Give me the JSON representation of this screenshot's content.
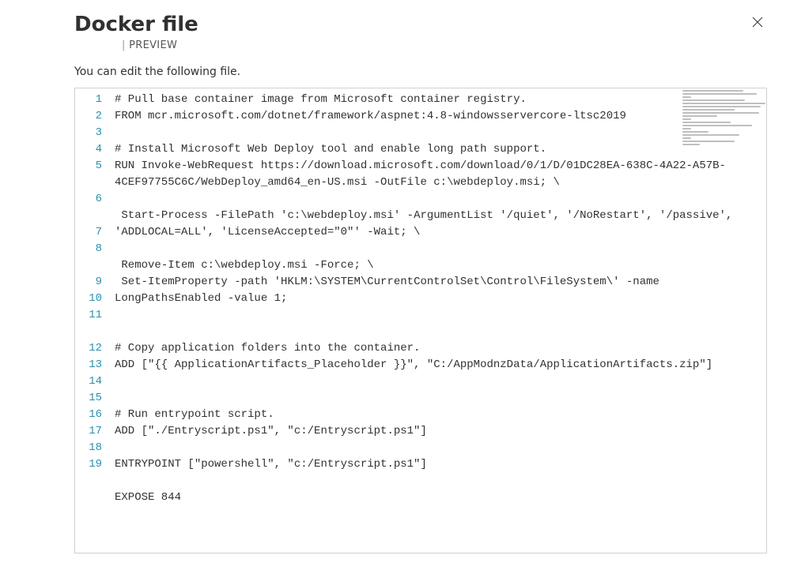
{
  "header": {
    "title": "Docker file",
    "divider": "|",
    "preview": "PREVIEW"
  },
  "subtitle": "You can edit the following file.",
  "lineNumbers": [
    "1",
    "2",
    "3",
    "4",
    "5",
    "",
    "6",
    "",
    "7",
    "8",
    "",
    "9",
    "10",
    "11",
    "",
    "12",
    "13",
    "14",
    "15",
    "16",
    "17",
    "18",
    "19"
  ],
  "codeLines": [
    "# Pull base container image from Microsoft container registry.",
    "FROM mcr.microsoft.com/dotnet/framework/aspnet:4.8-windowsservercore-ltsc2019",
    "",
    "# Install Microsoft Web Deploy tool and enable long path support.",
    "RUN Invoke-WebRequest https://download.microsoft.com/download/0/1/D/01DC28EA-638C-4A22-A57B-4CEF97755C6C/WebDeploy_amd64_en-US.msi -OutFile c:\\webdeploy.msi; \\",
    "",
    " Start-Process -FilePath 'c:\\webdeploy.msi' -ArgumentList '/quiet', '/NoRestart', '/passive', 'ADDLOCAL=ALL', 'LicenseAccepted=\"0\"' -Wait; \\",
    "",
    " Remove-Item c:\\webdeploy.msi -Force; \\",
    " Set-ItemProperty -path 'HKLM:\\SYSTEM\\CurrentControlSet\\Control\\FileSystem\\' -name LongPathsEnabled -value 1;",
    "",
    "",
    "# Copy application folders into the container.",
    "ADD [\"{{ ApplicationArtifacts_Placeholder }}\", \"C:/AppModnzData/ApplicationArtifacts.zip\"]",
    "",
    "",
    "# Run entrypoint script.",
    "ADD [\"./Entryscript.ps1\", \"c:/Entryscript.ps1\"]",
    "",
    "ENTRYPOINT [\"powershell\", \"c:/Entryscript.ps1\"]",
    "",
    "EXPOSE 844",
    ""
  ]
}
